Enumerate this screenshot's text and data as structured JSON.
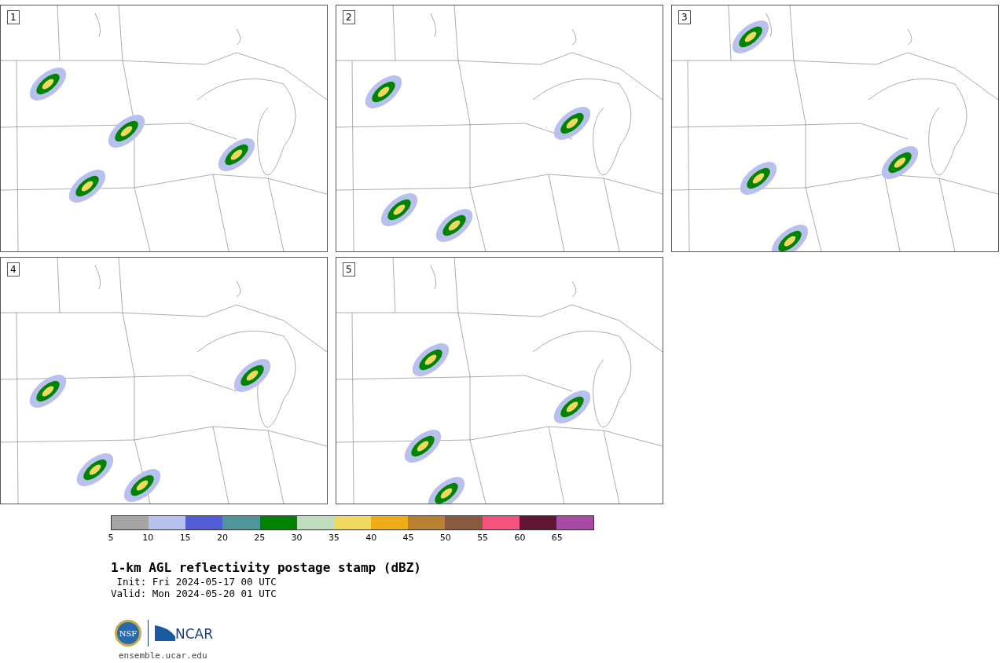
{
  "panels": [
    {
      "label": "1"
    },
    {
      "label": "2"
    },
    {
      "label": "3"
    },
    {
      "label": "4"
    },
    {
      "label": "5"
    }
  ],
  "colorbar": {
    "segments": [
      {
        "color": "#a5a5a5"
      },
      {
        "color": "#b8c1ee"
      },
      {
        "color": "#525ed8"
      },
      {
        "color": "#4e969c"
      },
      {
        "color": "#008300"
      },
      {
        "color": "#bfdcbf"
      },
      {
        "color": "#efd95e"
      },
      {
        "color": "#eeac19"
      },
      {
        "color": "#b9812f"
      },
      {
        "color": "#8a5a3e"
      },
      {
        "color": "#f5527d"
      },
      {
        "color": "#631534"
      },
      {
        "color": "#a84aa6"
      }
    ],
    "ticks": [
      "5",
      "10",
      "15",
      "20",
      "25",
      "30",
      "35",
      "40",
      "45",
      "50",
      "55",
      "60",
      "65"
    ]
  },
  "title": "1-km AGL reflectivity postage stamp (dBZ)",
  "init": " Init: Fri 2024-05-17 00 UTC",
  "valid": "Valid: Mon 2024-05-20 01 UTC",
  "logo": {
    "seal": "NSF",
    "wordmark": "NCAR"
  },
  "site": "ensemble.ucar.edu"
}
